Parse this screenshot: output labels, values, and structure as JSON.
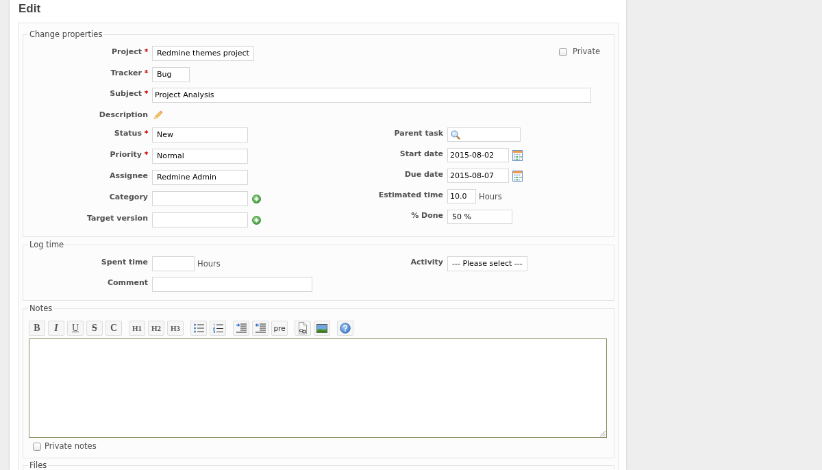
{
  "page": {
    "title": "Edit"
  },
  "properties": {
    "legend": "Change properties",
    "private": {
      "label": "Private",
      "checked": false
    },
    "top_fields": [
      {
        "kind": "select",
        "label": "Project",
        "required": true,
        "value": "Redmine themes project"
      },
      {
        "kind": "select",
        "label": "Tracker",
        "required": true,
        "value": "Bug"
      },
      {
        "kind": "text",
        "label": "Subject",
        "required": true,
        "value": "Project Analysis"
      },
      {
        "kind": "edit_link",
        "label": "Description",
        "required": false
      }
    ],
    "left_fields": [
      {
        "kind": "select",
        "label": "Status",
        "required": true,
        "value": "New"
      },
      {
        "kind": "select",
        "label": "Priority",
        "required": true,
        "value": "Normal"
      },
      {
        "kind": "select",
        "label": "Assignee",
        "required": false,
        "value": "Redmine Admin"
      },
      {
        "kind": "select_add",
        "label": "Category",
        "required": false
      },
      {
        "kind": "select_add",
        "label": "Target version",
        "required": false
      }
    ],
    "right_fields": [
      {
        "kind": "search",
        "label": "Parent task",
        "required": false
      },
      {
        "kind": "date",
        "label": "Start date",
        "required": false,
        "value": "2015-08-02"
      },
      {
        "kind": "date",
        "label": "Due date",
        "required": false,
        "value": "2015-08-07"
      },
      {
        "kind": "text_unit",
        "label": "Estimated time",
        "required": false,
        "value": "10.0",
        "unit": "Hours"
      },
      {
        "kind": "select",
        "label": "% Done",
        "required": false,
        "value": "50 %"
      }
    ]
  },
  "log_time": {
    "legend": "Log time",
    "left_fields": [
      {
        "kind": "text_unit",
        "label": "Spent time",
        "required": false,
        "unit": "Hours"
      },
      {
        "kind": "text",
        "label": "Comment",
        "required": false
      }
    ],
    "right_fields": [
      {
        "kind": "select",
        "label": "Activity",
        "required": false,
        "value": "--- Please select ---"
      }
    ]
  },
  "notes": {
    "legend": "Notes",
    "toolbar_groups": [
      [
        {
          "kind": "bold",
          "label": "B"
        },
        {
          "kind": "italic",
          "label": "I"
        },
        {
          "kind": "underline",
          "label": "U"
        },
        {
          "kind": "strike",
          "label": "S"
        },
        {
          "kind": "code",
          "label": "C"
        }
      ],
      [
        {
          "kind": "heading",
          "label": "H1"
        },
        {
          "kind": "heading",
          "label": "H2"
        },
        {
          "kind": "heading",
          "label": "H3"
        }
      ],
      [
        {
          "kind": "bullet_list"
        },
        {
          "kind": "numbered_list"
        }
      ],
      [
        {
          "kind": "indent"
        },
        {
          "kind": "outdent"
        },
        {
          "kind": "pre",
          "label": "pre"
        }
      ],
      [
        {
          "kind": "link"
        },
        {
          "kind": "image"
        }
      ],
      [
        {
          "kind": "help"
        }
      ]
    ],
    "private_notes": {
      "label": "Private notes",
      "checked": false
    }
  },
  "files": {
    "legend": "Files"
  }
}
